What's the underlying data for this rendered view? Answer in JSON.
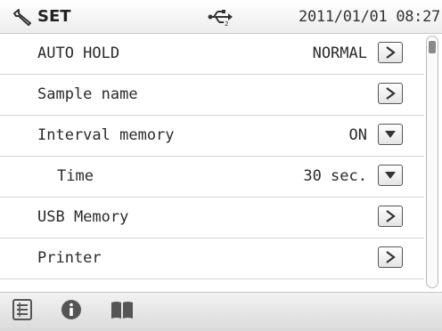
{
  "header": {
    "title": "SET",
    "datetime": "2011/01/01 08:27",
    "icons": [
      "wrench-icon",
      "usb-icon"
    ]
  },
  "rows": [
    {
      "label": "AUTO HOLD",
      "value": "NORMAL",
      "control": "arrow-right-icon"
    },
    {
      "label": "Sample name",
      "value": "",
      "control": "arrow-right-icon"
    },
    {
      "label": "Interval memory",
      "value": "ON",
      "control": "dropdown-icon"
    },
    {
      "label": "Time",
      "value": "30 sec.",
      "control": "dropdown-icon"
    },
    {
      "label": "USB Memory",
      "value": "",
      "control": "arrow-right-icon"
    },
    {
      "label": "Printer",
      "value": "",
      "control": "arrow-right-icon"
    }
  ],
  "footer": {
    "icons": [
      "list-icon",
      "info-icon",
      "book-icon"
    ]
  },
  "colors": {
    "icon": "#555555",
    "divider": "#d4d4d4",
    "scroll_thumb": "#8a8a8a"
  }
}
